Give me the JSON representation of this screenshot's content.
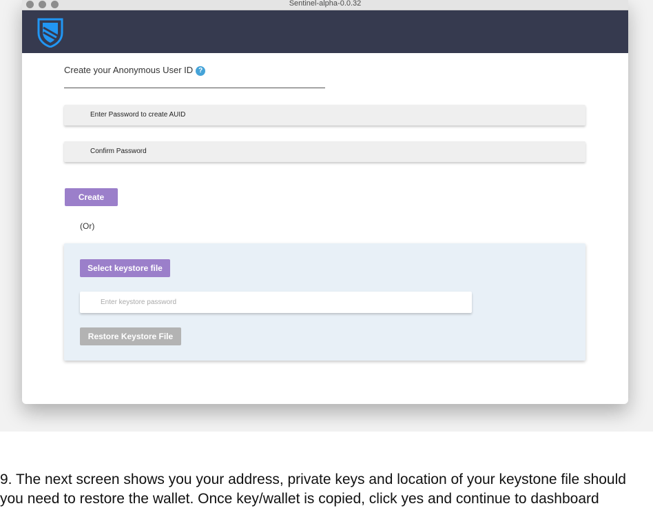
{
  "window": {
    "title": "Sentinel-alpha-0.0.32"
  },
  "header": {
    "logo_icon": "shield-logo-icon"
  },
  "form": {
    "title": "Create your Anonymous User ID",
    "help_icon": "?",
    "password_placeholder": "Enter Password to create AUID",
    "confirm_placeholder": "Confirm Password",
    "create_label": "Create",
    "or_label": "(Or)"
  },
  "restore": {
    "select_label": "Select keystore file",
    "password_placeholder": "Enter keystore password",
    "restore_label": "Restore Keystore File"
  },
  "caption": {
    "text": "9.  The next screen shows you your address, private keys and location of your keystone file should you need to restore the wallet.  Once key/wallet is copied, click yes and continue to dashboard"
  },
  "colors": {
    "header_bg": "#363a4f",
    "accent_purple": "#9b7fca",
    "disabled_gray": "#b3b3b3",
    "help_blue": "#45a3d8",
    "panel_bg": "#e8f0f7"
  }
}
